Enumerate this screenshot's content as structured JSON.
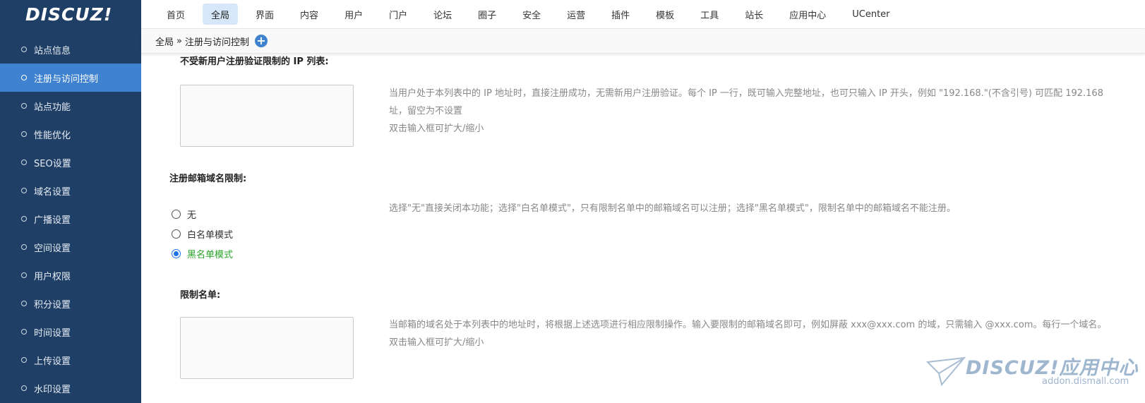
{
  "logo": "DISCUZ!",
  "sidebar": {
    "items": [
      {
        "label": "站点信息"
      },
      {
        "label": "注册与访问控制"
      },
      {
        "label": "站点功能"
      },
      {
        "label": "性能优化"
      },
      {
        "label": "SEO设置"
      },
      {
        "label": "域名设置"
      },
      {
        "label": "广播设置"
      },
      {
        "label": "空间设置"
      },
      {
        "label": "用户权限"
      },
      {
        "label": "积分设置"
      },
      {
        "label": "时间设置"
      },
      {
        "label": "上传设置"
      },
      {
        "label": "水印设置"
      }
    ],
    "active_index": 1
  },
  "topnav": {
    "items": [
      "首页",
      "全局",
      "界面",
      "内容",
      "用户",
      "门户",
      "论坛",
      "圈子",
      "安全",
      "运营",
      "插件",
      "模板",
      "工具",
      "站长",
      "应用中心",
      "UCenter"
    ],
    "active_index": 1
  },
  "breadcrumb": {
    "root": "全局",
    "sep": "»",
    "current": "注册与访问控制",
    "plus": "+"
  },
  "form": {
    "ip_list": {
      "label": "不受新用户注册验证限制的 IP 列表:",
      "value": "",
      "tip1": "当用户处于本列表中的 IP 地址时，直接注册成功，无需新用户注册验证。每个 IP 一行，既可输入完整地址，也可只输入 IP 开头，例如 \"192.168.\"(不含引号) 可匹配 192.168",
      "tip2": "址，留空为不设置",
      "tip3": "双击输入框可扩大/缩小"
    },
    "email_domain": {
      "label": "注册邮箱域名限制:",
      "options": [
        {
          "label": "无",
          "checked": false
        },
        {
          "label": "白名单模式",
          "checked": false
        },
        {
          "label": "黑名单模式",
          "checked": true
        }
      ],
      "tip": "选择\"无\"直接关闭本功能；选择\"白名单模式\"，只有限制名单中的邮箱域名可以注册；选择\"黑名单模式\"，限制名单中的邮箱域名不能注册。"
    },
    "restrict_list": {
      "label": "限制名单:",
      "value": "",
      "tip1": "当邮箱的域名处于本列表中的地址时，将根据上述选项进行相应限制操作。输入要限制的邮箱域名即可，例如屏蔽 xxx@xxx.com 的域，只需输入 @xxx.com。每行一个域名。",
      "tip2": "双击输入框可扩大/缩小"
    }
  },
  "watermark": {
    "brand": "DISCUZ!应用中心",
    "url": "addon.dismall.com"
  }
}
